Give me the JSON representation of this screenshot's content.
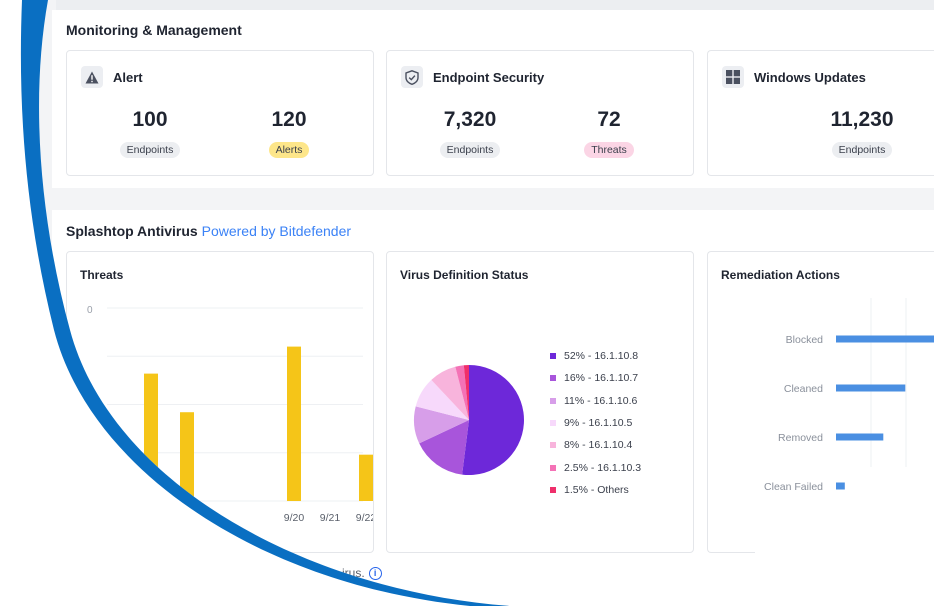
{
  "monitoring": {
    "title": "Monitoring & Management",
    "cards": [
      {
        "title": "Alert",
        "icon": "warning-icon",
        "metrics": [
          {
            "value": "100",
            "label": "Endpoints"
          },
          {
            "value": "120",
            "label": "Alerts"
          }
        ]
      },
      {
        "title": "Endpoint Security",
        "icon": "shield-check-icon",
        "metrics": [
          {
            "value": "7,320",
            "label": "Endpoints"
          },
          {
            "value": "72",
            "label": "Threats"
          }
        ]
      },
      {
        "title": "Windows Updates",
        "icon": "windows-icon",
        "metrics": [
          {
            "value": "11,230",
            "label": "Endpoints"
          }
        ]
      }
    ]
  },
  "antivirus": {
    "title": "Splashtop Antivirus",
    "powered_by": "Powered by Bitdefender",
    "footer_note": "irus.",
    "threats": {
      "title": "Threats",
      "y_top_label": "0"
    },
    "virus_definition": {
      "title": "Virus Definition Status"
    },
    "remediation": {
      "title": "Remediation Actions"
    }
  },
  "chart_data": [
    {
      "type": "bar",
      "title": "Threats",
      "categories": [
        "9/20",
        "9/21",
        "9/22"
      ],
      "note": "bars partially hidden behind curved overlay",
      "bars": [
        {
          "x_label": "",
          "value": 3.3
        },
        {
          "x_label": "",
          "value": 2.3
        },
        {
          "x_label": "9/20",
          "value": 4.0
        },
        {
          "x_label": "9/21",
          "value": 0
        },
        {
          "x_label": "9/22",
          "value": 1.2
        }
      ],
      "ylim": [
        0,
        5
      ],
      "color": "#f5c518"
    },
    {
      "type": "pie",
      "title": "Virus Definition Status",
      "slices": [
        {
          "label": "52% - 16.1.10.8",
          "value": 52,
          "color": "#6d28d9"
        },
        {
          "label": "16% - 16.1.10.7",
          "value": 16,
          "color": "#a855db"
        },
        {
          "label": "11% - 16.1.10.6",
          "value": 11,
          "color": "#d79ee9"
        },
        {
          "label": "9% - 16.1.10.5",
          "value": 9,
          "color": "#f7d9fb"
        },
        {
          "label": "8% - 16.1.10.4",
          "value": 8,
          "color": "#f8b4dc"
        },
        {
          "label": "2.5% - 16.1.10.3",
          "value": 2.5,
          "color": "#f472b6"
        },
        {
          "label": "1.5% - Others",
          "value": 1.5,
          "color": "#ef2f6b"
        }
      ]
    },
    {
      "type": "bar",
      "orientation": "horizontal",
      "title": "Remediation Actions",
      "categories": [
        "Blocked",
        "Cleaned",
        "Removed",
        "Clean Failed"
      ],
      "values": [
        100,
        63,
        43,
        8
      ],
      "xlim": [
        0,
        100
      ],
      "color": "#4a8fe2"
    }
  ],
  "colors": {
    "accent": "#3b82f6",
    "arc": "#0a6fc2",
    "yellow": "#f5c518"
  }
}
